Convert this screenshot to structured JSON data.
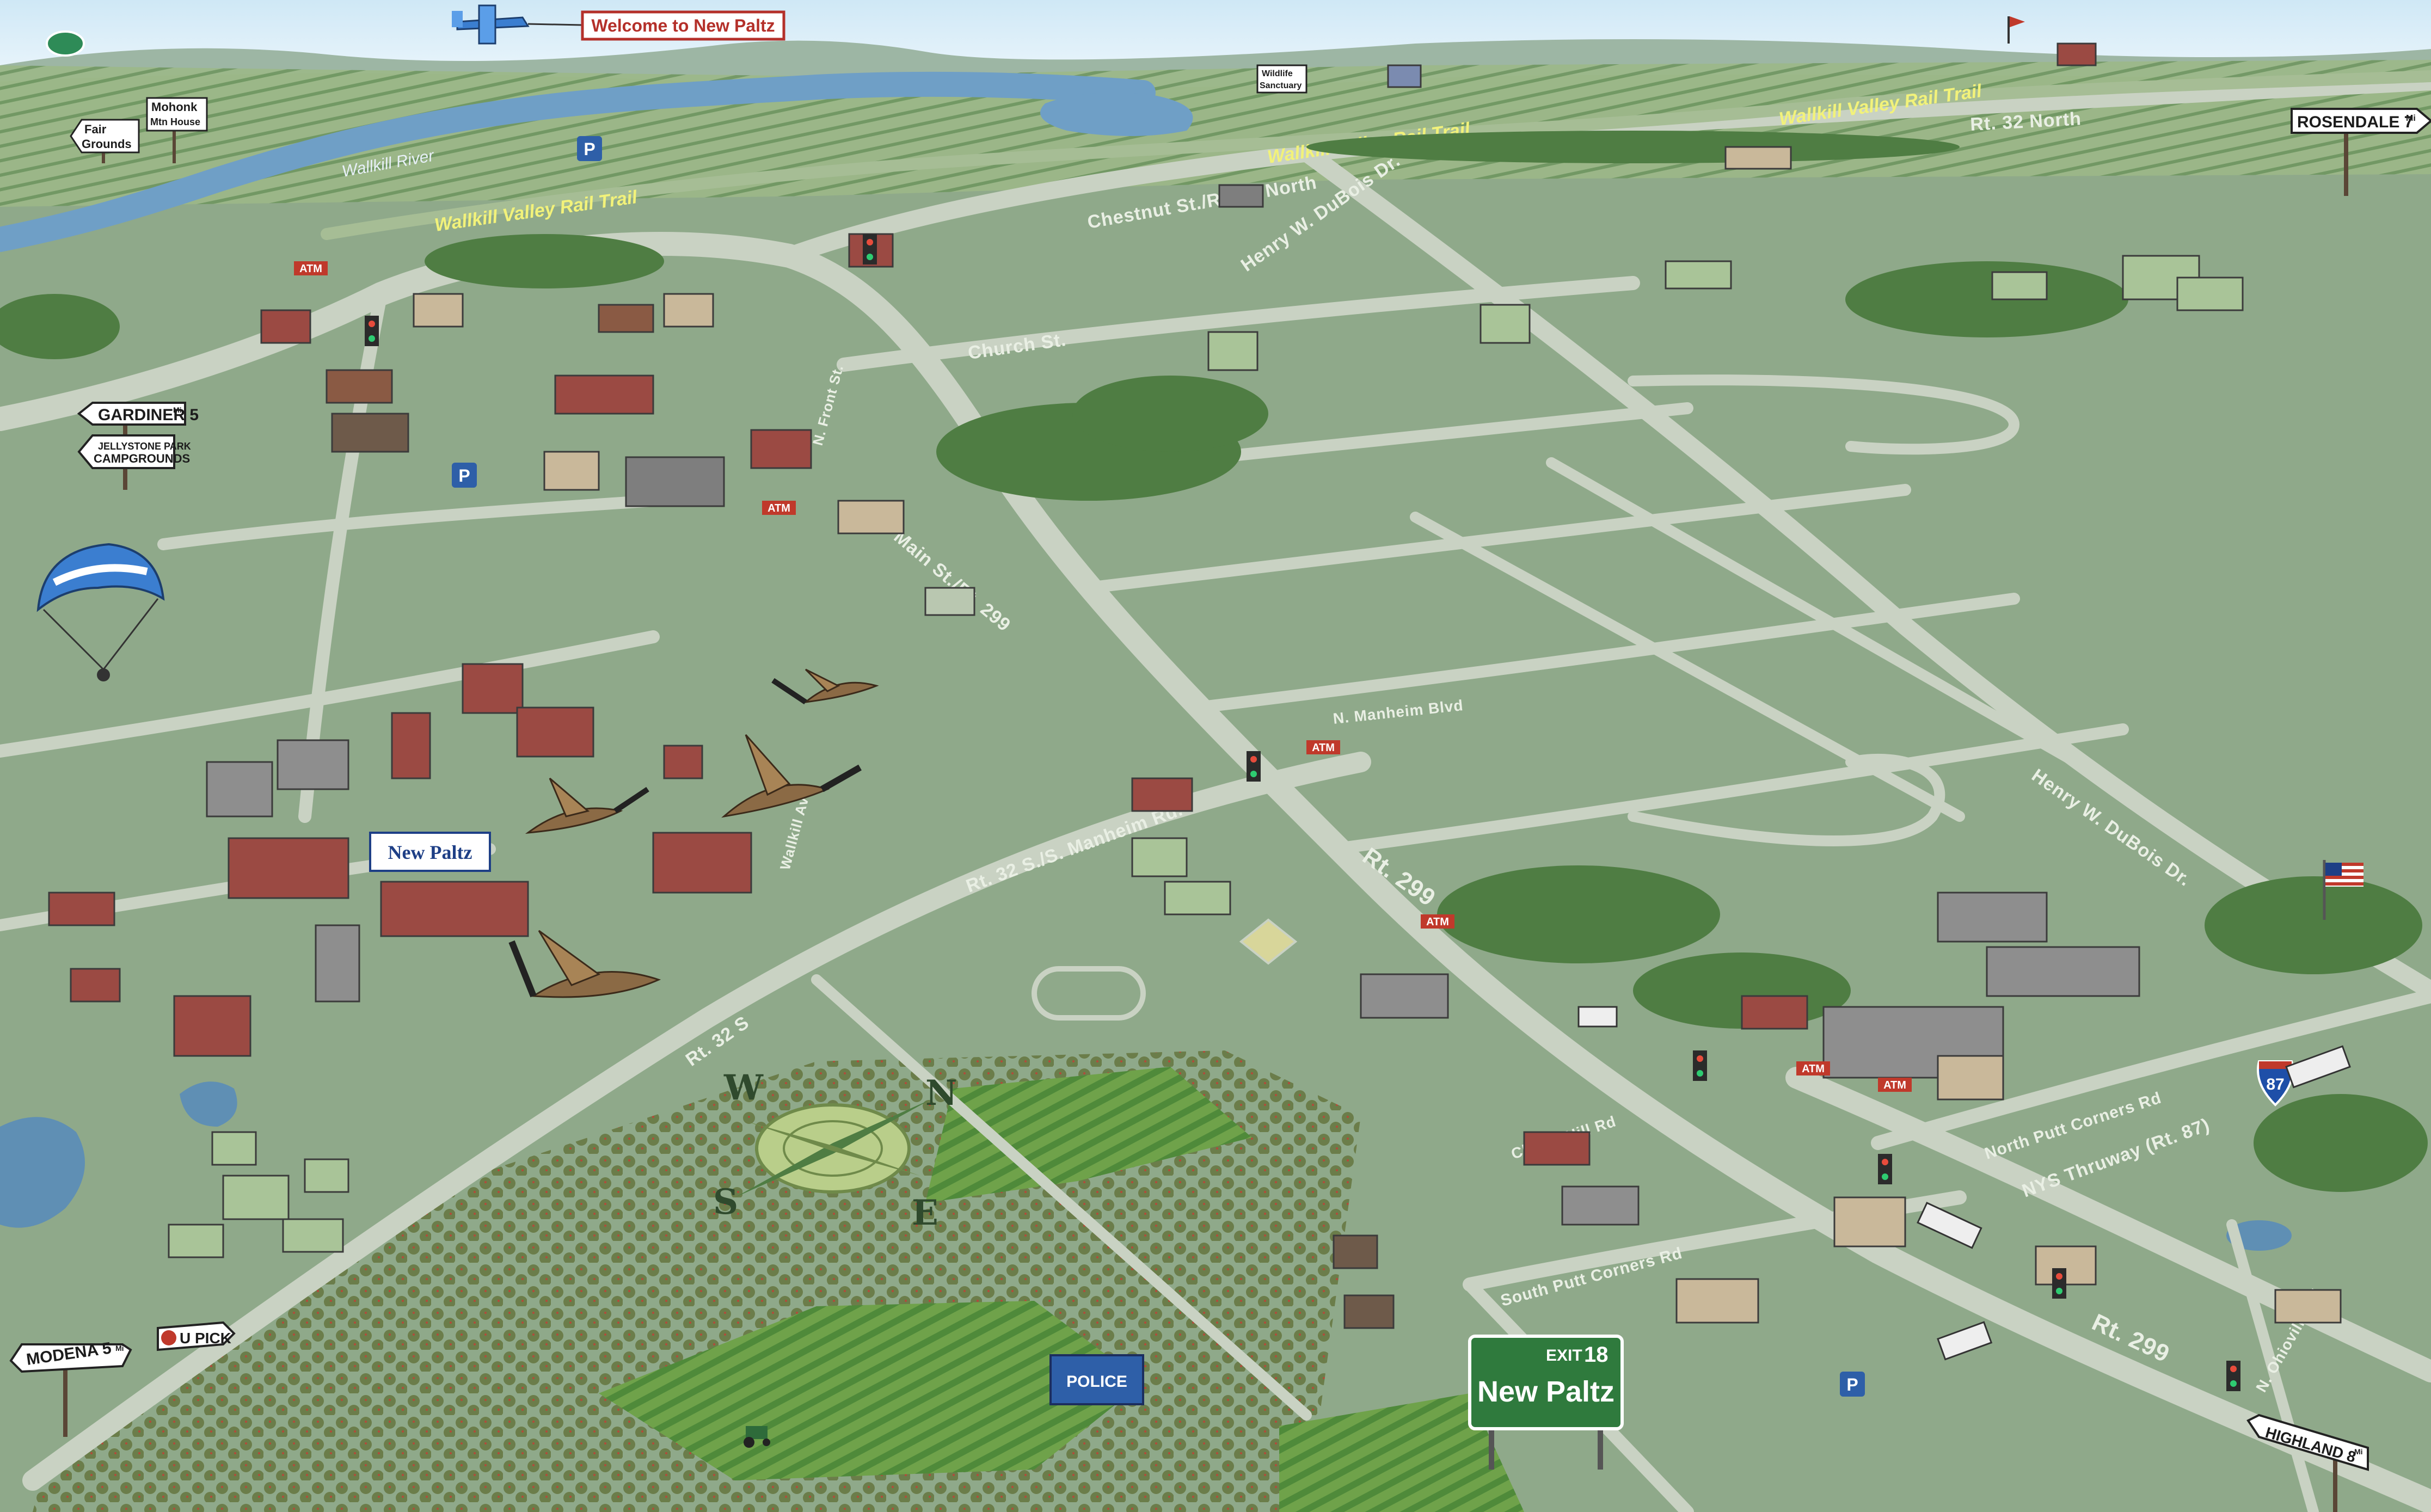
{
  "banner": {
    "text": "Welcome to New Paltz"
  },
  "signs": {
    "rosendale": {
      "text": "ROSENDALE 7",
      "unit": "Mi"
    },
    "gardiner": {
      "text": "GARDINER 5",
      "unit": "Mi"
    },
    "jellystone_line1": "JELLYSTONE PARK",
    "jellystone_line2": "CAMPGROUNDS",
    "modena": {
      "text": "MODENA 5",
      "unit": "Mi"
    },
    "upick": "U PICK",
    "highland": {
      "text": "HIGHLAND 8",
      "unit": "Mi"
    },
    "fairgrounds_line1": "Fair",
    "fairgrounds_line2": "Grounds",
    "mohonk_line1": "Mohonk",
    "mohonk_line2": "Mtn House",
    "wildlife_line1": "Wildlife",
    "wildlife_line2": "Sanctuary"
  },
  "exit_sign": {
    "exit": "EXIT",
    "number": "18",
    "name": "New Paltz"
  },
  "interstate": {
    "route": "87"
  },
  "college_logo": {
    "text": "New Paltz"
  },
  "police": {
    "text": "POLICE"
  },
  "atm_label": "ATM",
  "parking_label": "P",
  "labels": {
    "rail_trail": "Wallkill Valley Rail Trail",
    "wallkill_river": "Wallkill River",
    "rt32_north": "Rt. 32 North",
    "church_st": "Church St.",
    "chestnut_st": "Chestnut St./Rt. 32 North",
    "henry_dubois_1": "Henry W. DuBois Dr.",
    "henry_dubois_2": "Henry W. DuBois Dr.",
    "main_st": "Main St./Rt. 299",
    "rt299_1": "Rt. 299",
    "rt299_2": "Rt. 299",
    "rt32_manheim": "Rt. 32 S./S. Manheim Rd.",
    "rt32_s": "Rt. 32 S",
    "n_manheim": "N. Manheim Blvd",
    "south_putt": "South Putt Corners Rd",
    "north_putt": "North Putt Corners Rd",
    "nys_thruway": "NYS Thruway (Rt. 87)",
    "n_ohioville": "N. Ohioville Rd",
    "cherry_hill": "Cherry Hill Rd",
    "wallkill_ave": "Wallkill Ave",
    "n_front": "N. Front St."
  },
  "compass": {
    "n": "N",
    "e": "E",
    "s": "S",
    "w": "W"
  },
  "colors": {
    "grass": "#8fa98a",
    "road": "#c9d2c3",
    "sky": "#d6ecf7",
    "river": "#6f9fc6",
    "tree": "#4f7d43",
    "building_red": "#9b4a43",
    "rail_text": "#f2f27a",
    "exit_sign_green": "#2f7a3d"
  }
}
